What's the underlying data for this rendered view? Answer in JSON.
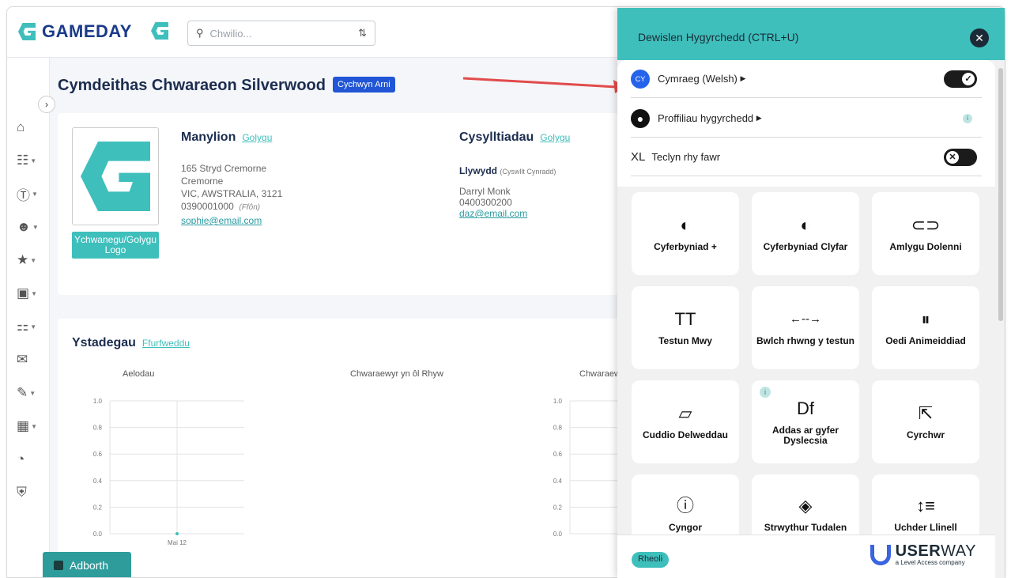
{
  "app": {
    "brand": "GAMEDAY",
    "search_placeholder": "Chwilio..."
  },
  "club": {
    "title": "Cymdeithas Chwaraeon Silverwood",
    "start_badge": "Cychwyn Arni",
    "logo_button": "Ychwanegu/Golygu Logo"
  },
  "details": {
    "heading": "Manylion",
    "edit": "Golygu",
    "street": "165 Stryd Cremorne",
    "suburb": "Cremorne",
    "state": "VIC, AWSTRALIA, 3121",
    "phone": "0390001000",
    "phone_label": "(Ffôn)",
    "email": "sophie@email.com"
  },
  "contacts": {
    "heading": "Cysylltiadau",
    "edit": "Golygu",
    "role": "Llywydd",
    "role_note": "(Cyswllt Cynradd)",
    "name": "Darryl Monk",
    "phone": "0400300200",
    "email": "daz@email.com"
  },
  "stats": {
    "heading": "Ystadegau",
    "configure": "Ffurfweddu",
    "charts": [
      {
        "title": "Aelodau"
      },
      {
        "title": "Chwaraewyr yn ôl Rhyw"
      },
      {
        "title": "Chwaraewyr"
      }
    ]
  },
  "chart_data": [
    {
      "type": "line",
      "title": "Aelodau",
      "x": [
        "Mai 12"
      ],
      "series": [
        {
          "values": [
            0
          ]
        }
      ],
      "ylim": [
        0,
        1
      ],
      "yticks": [
        "1.0",
        "0.8",
        "0.6",
        "0.4",
        "0.2",
        "0.0"
      ],
      "grid": true
    },
    {
      "type": "line",
      "title": "Chwaraewyr",
      "x": [],
      "series": [],
      "ylim": [
        0,
        1
      ],
      "yticks": [
        "1.0",
        "0.8",
        "0.6",
        "0.4",
        "0.2",
        "0.0"
      ],
      "grid": true
    }
  ],
  "feedback": {
    "label": "Adborth"
  },
  "accessibility": {
    "title": "Dewislen Hygyrchedd (CTRL+U)",
    "language_code": "CY",
    "language": "Cymraeg (Welsh)",
    "profiles": "Proffiliau hygyrchedd",
    "oversize_code": "XL",
    "oversize": "Teclyn rhy fawr",
    "tiles": [
      {
        "icon": "contrast-icon",
        "glyph": "◐",
        "label": "Cyferbyniad +"
      },
      {
        "icon": "smart-contrast-icon",
        "glyph": "◐",
        "label": "Cyferbyniad Clyfar"
      },
      {
        "icon": "link-icon",
        "glyph": "⊂⊃",
        "label": "Amlygu Dolenni"
      },
      {
        "icon": "text-size-icon",
        "glyph": "TT",
        "label": "Testun Mwy"
      },
      {
        "icon": "text-spacing-icon",
        "glyph": "←--→",
        "label": "Bwlch rhwng y testun"
      },
      {
        "icon": "pause-animation-icon",
        "glyph": "⏸",
        "label": "Oedi Animeiddiad"
      },
      {
        "icon": "hide-images-icon",
        "glyph": "▱",
        "label": "Cuddio Delweddau"
      },
      {
        "icon": "dyslexia-icon",
        "glyph": "Df",
        "label": "Addas ar gyfer Dyslecsia"
      },
      {
        "icon": "cursor-icon",
        "glyph": "⇱",
        "label": "Cyrchwr"
      },
      {
        "icon": "tooltip-icon",
        "glyph": "ⓘ",
        "label": "Cyngor"
      },
      {
        "icon": "page-structure-icon",
        "glyph": "◈",
        "label": "Strwythur Tudalen"
      },
      {
        "icon": "line-height-icon",
        "glyph": "↕≡",
        "label": "Uchder Llinell"
      }
    ],
    "manage": "Rheoli",
    "userway_brand": "USER",
    "userway_brand2": "WAY",
    "userway_tagline": "a Level Access company"
  }
}
